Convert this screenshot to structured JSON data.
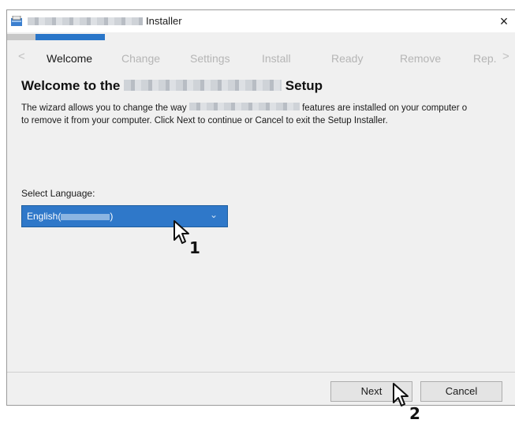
{
  "window": {
    "title": "Installer",
    "close_glyph": "×"
  },
  "steps": {
    "prev_arrow": "<",
    "next_arrow": ">",
    "items": [
      "Welcome",
      "Change",
      "Settings",
      "Install",
      "Ready",
      "Remove",
      "Rep."
    ],
    "active_index": 0
  },
  "page": {
    "heading_prefix": "Welcome to the",
    "heading_suffix": "Setup",
    "desc_line1_start": "The wizard allows you to change the way",
    "desc_line1_end": "features are installed on your computer o",
    "desc_line2": "to remove it from your computer. Click Next to continue or Cancel to exit the Setup Installer."
  },
  "language": {
    "label": "Select Language:",
    "selected_prefix": "English(",
    "selected_suffix": ")",
    "chevron": "⌄"
  },
  "footer": {
    "next_label": "Next",
    "cancel_label": "Cancel"
  },
  "callouts": {
    "cursor1": "1",
    "cursor2": "2"
  },
  "colors": {
    "accent": "#2f78c9",
    "progress": "#2a76c9"
  },
  "progress": {
    "fraction": 0.14
  }
}
